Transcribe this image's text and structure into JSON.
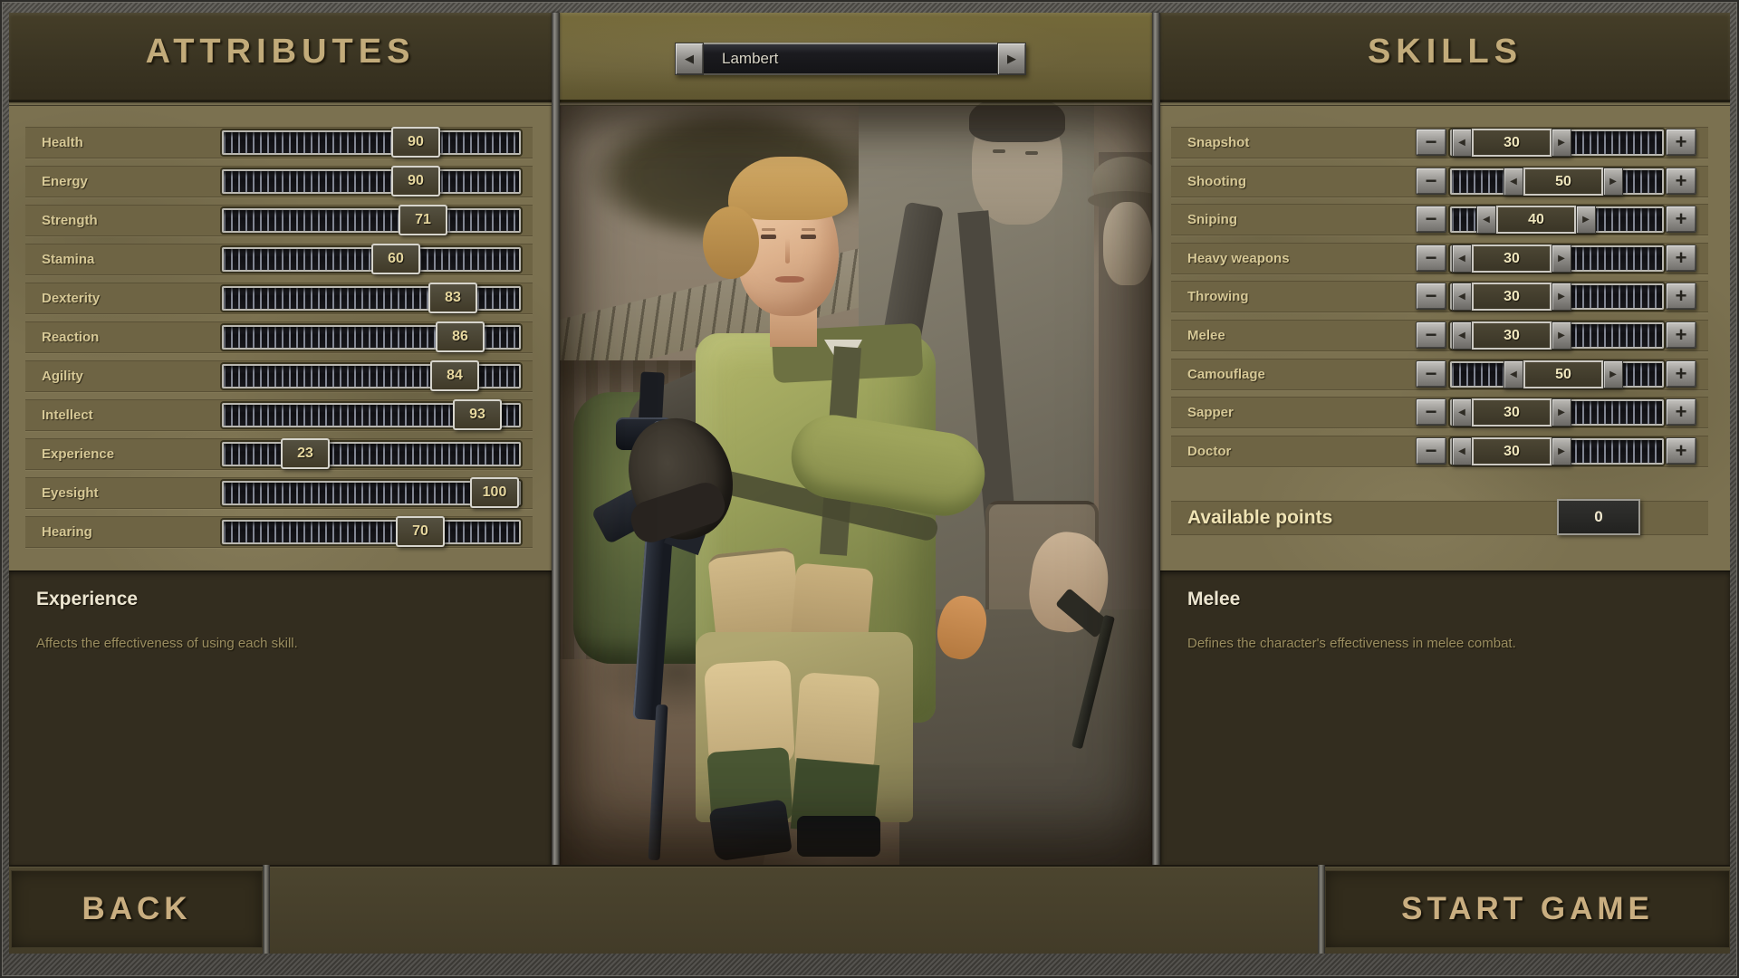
{
  "attributes": {
    "title": "ATTRIBUTES",
    "rows": [
      {
        "label": "Health",
        "value": "90",
        "pos": 0.68
      },
      {
        "label": "Energy",
        "value": "90",
        "pos": 0.68
      },
      {
        "label": "Strength",
        "value": "71",
        "pos": 0.71
      },
      {
        "label": "Stamina",
        "value": "60",
        "pos": 0.6
      },
      {
        "label": "Dexterity",
        "value": "83",
        "pos": 0.83
      },
      {
        "label": "Reaction",
        "value": "86",
        "pos": 0.86
      },
      {
        "label": "Agility",
        "value": "84",
        "pos": 0.84
      },
      {
        "label": "Intellect",
        "value": "93",
        "pos": 0.93
      },
      {
        "label": "Experience",
        "value": "23",
        "pos": 0.23
      },
      {
        "label": "Eyesight",
        "value": "100",
        "pos": 1.0
      },
      {
        "label": "Hearing",
        "value": "70",
        "pos": 0.7
      }
    ]
  },
  "skills": {
    "title": "SKILLS",
    "minus_icon": "−",
    "plus_icon": "+",
    "left_arrow_icon": "◀",
    "right_arrow_icon": "▶",
    "rows": [
      {
        "label": "Snapshot",
        "value": "30",
        "pos": 0
      },
      {
        "label": "Shooting",
        "value": "50",
        "pos": 0.57
      },
      {
        "label": "Sniping",
        "value": "40",
        "pos": 0.27
      },
      {
        "label": "Heavy weapons",
        "value": "30",
        "pos": 0
      },
      {
        "label": "Throwing",
        "value": "30",
        "pos": 0
      },
      {
        "label": "Melee",
        "value": "30",
        "pos": 0
      },
      {
        "label": "Camouflage",
        "value": "50",
        "pos": 0.57
      },
      {
        "label": "Sapper",
        "value": "30",
        "pos": 0
      },
      {
        "label": "Doctor",
        "value": "30",
        "pos": 0
      }
    ],
    "available_points": {
      "label": "Available points",
      "value": "0"
    }
  },
  "character_selector": {
    "name": "Lambert",
    "prev_icon": "◀",
    "next_icon": "▶"
  },
  "attribute_info": {
    "title": "Experience",
    "description": "Affects the effectiveness of using each skill."
  },
  "skill_info": {
    "title": "Melee",
    "description": "Defines the character's effectiveness in melee combat."
  },
  "footer": {
    "back_label": "BACK",
    "start_label": "START GAME"
  },
  "portrait": {
    "alt": "Blonde female soldier in green fatigues with slung rifle, embraced by two sepia-toned soldiers in front of a village hut"
  },
  "colors": {
    "panel": "#7b7150",
    "header_band": "#3a3422",
    "dark_panel": "#332d1f",
    "accent_text": "#c2ab7a",
    "label_text": "#d6c896",
    "value_text": "#e6d79e",
    "track": "#141318",
    "metal": "#9a9894"
  }
}
